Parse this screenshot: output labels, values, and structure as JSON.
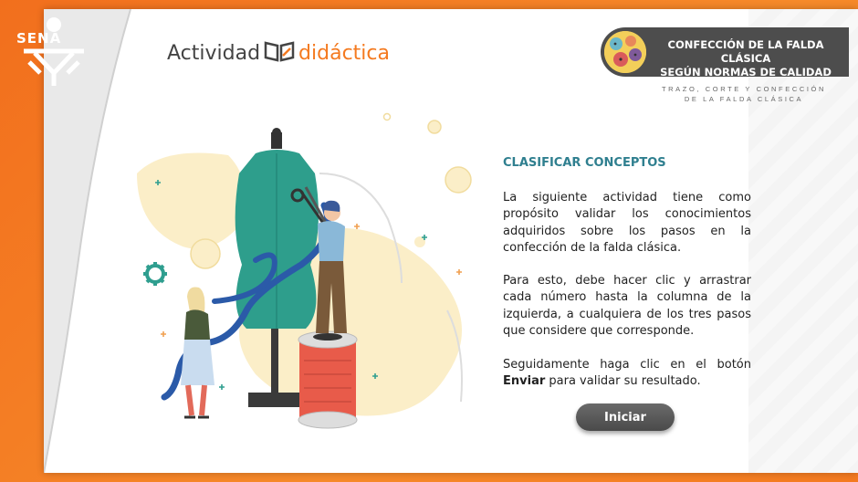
{
  "brand": {
    "logo_text": "SENA"
  },
  "header": {
    "activity_word": "Actividad",
    "activity_accent": "didáctica",
    "badge_line1": "CONFECCIÓN DE LA FALDA CLÁSICA",
    "badge_line2": "SEGÚN NORMAS DE CALIDAD",
    "subtitle_line1": "TRAZO, CORTE Y CONFECCIÓN",
    "subtitle_line2": "DE LA FALDA CLÁSICA"
  },
  "content": {
    "section_title": "CLASIFICAR CONCEPTOS",
    "paragraph1": "La siguiente actividad tiene como propósito validar los conocimientos adquiridos sobre los pasos en la confección de la falda clásica.",
    "paragraph2": "Para esto, debe hacer clic y arrastrar cada número hasta la columna de la izquierda, a cualquiera de los tres pasos que considere que corresponde.",
    "paragraph3_prefix": "Seguidamente haga clic en el botón ",
    "paragraph3_bold": "Enviar",
    "paragraph3_suffix": " para validar su resultado.",
    "start_button": "Iniciar"
  },
  "colors": {
    "orange": "#f47a20",
    "teal": "#2f9e8f",
    "title_blue": "#2f7f8f",
    "badge_gray": "#4d4d4d"
  }
}
